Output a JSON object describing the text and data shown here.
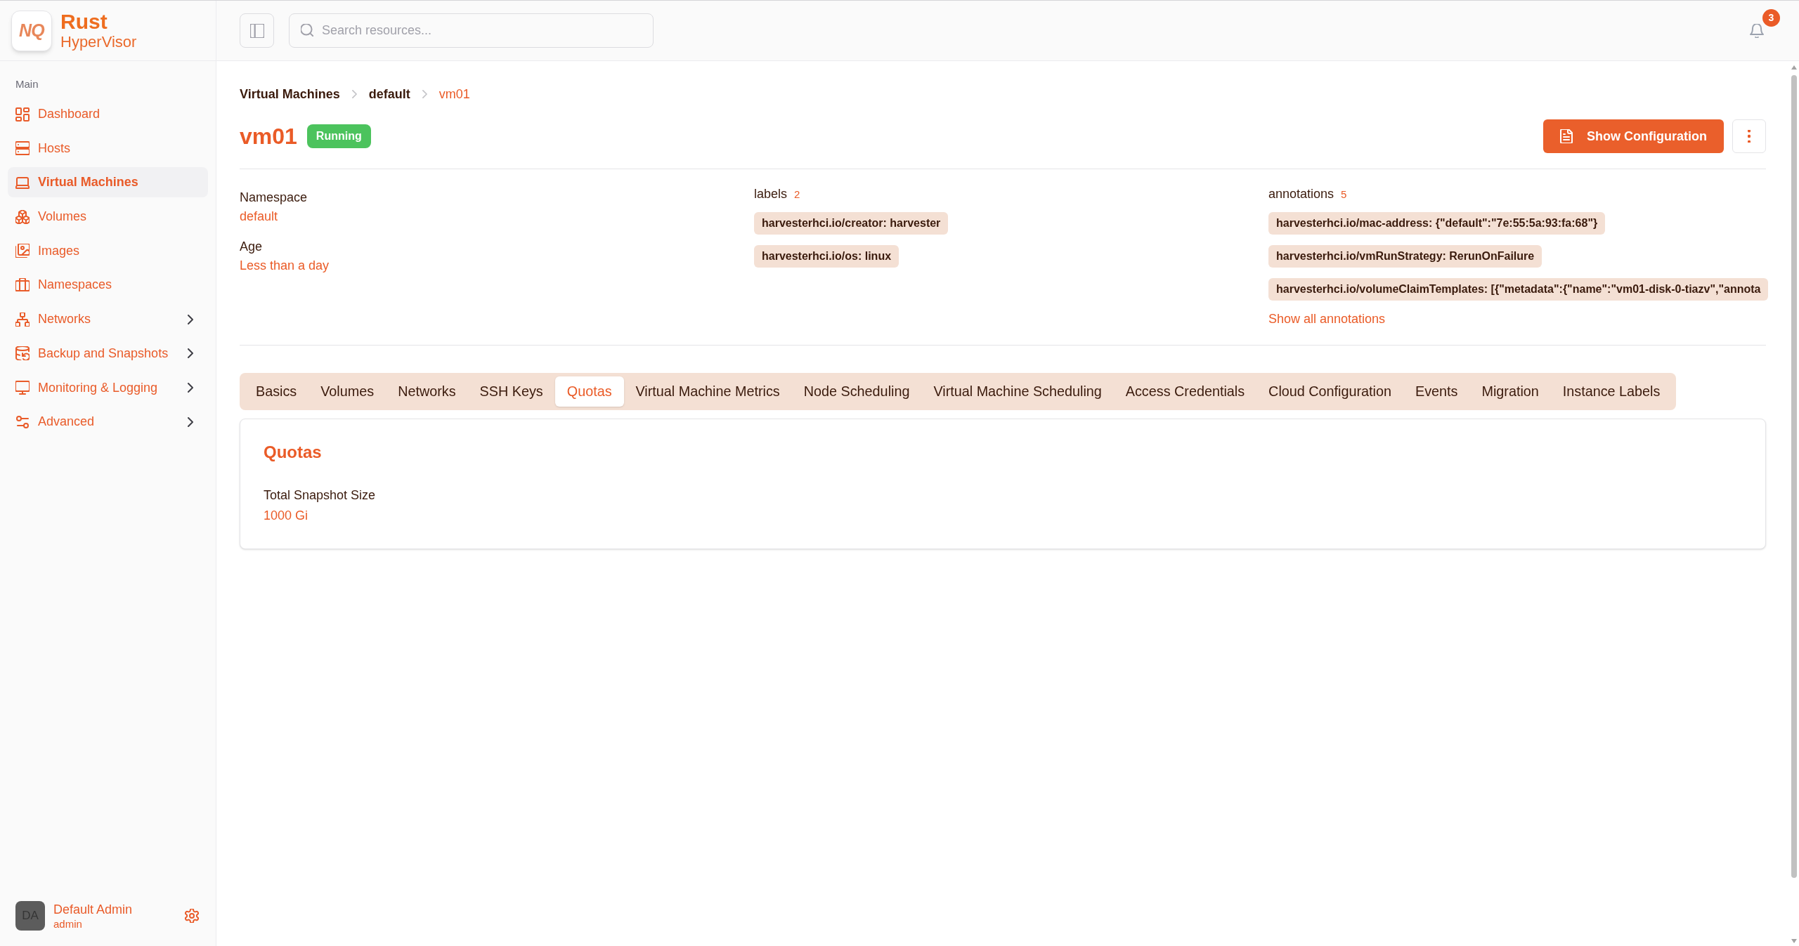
{
  "sidebar": {
    "brand": {
      "mark": "NQ",
      "name": "Rust",
      "subtitle": "HyperVisor"
    },
    "section_label": "Main",
    "items": [
      {
        "label": "Dashboard",
        "selected": false,
        "has_submenu": false
      },
      {
        "label": "Hosts",
        "selected": false,
        "has_submenu": false
      },
      {
        "label": "Virtual Machines",
        "selected": true,
        "has_submenu": false
      },
      {
        "label": "Volumes",
        "selected": false,
        "has_submenu": false
      },
      {
        "label": "Images",
        "selected": false,
        "has_submenu": false
      },
      {
        "label": "Namespaces",
        "selected": false,
        "has_submenu": false
      },
      {
        "label": "Networks",
        "selected": false,
        "has_submenu": true
      },
      {
        "label": "Backup and Snapshots",
        "selected": false,
        "has_submenu": true
      },
      {
        "label": "Monitoring & Logging",
        "selected": false,
        "has_submenu": true
      },
      {
        "label": "Advanced",
        "selected": false,
        "has_submenu": true
      }
    ],
    "user": {
      "initials": "DA",
      "name": "Default Admin",
      "role": "admin"
    }
  },
  "topbar": {
    "search": {
      "placeholder": "Search resources..."
    },
    "notifications": {
      "count": "3"
    }
  },
  "breadcrumb": [
    {
      "label": "Virtual Machines",
      "current": false
    },
    {
      "label": "default",
      "current": false
    },
    {
      "label": "vm01",
      "current": true
    }
  ],
  "header": {
    "title": "vm01",
    "status": "Running",
    "primary_action": "Show Configuration"
  },
  "details": [
    {
      "label": "Namespace",
      "value": "default"
    },
    {
      "label": "Age",
      "value": "Less than a day"
    }
  ],
  "labels": {
    "title": "labels",
    "count": "2",
    "items": [
      "harvesterhci.io/creator: harvester",
      "harvesterhci.io/os: linux"
    ]
  },
  "annotations": {
    "title": "annotations",
    "count": "5",
    "items": [
      "harvesterhci.io/mac-address: {\"default\":\"7e:55:5a:93:fa:68\"}",
      "harvesterhci.io/vmRunStrategy: RerunOnFailure",
      "harvesterhci.io/volumeClaimTemplates: [{\"metadata\":{\"name\":\"vm01-disk-0-tiazv\",\"annota"
    ],
    "link": "Show all annotations"
  },
  "tabs": [
    {
      "label": "Basics",
      "selected": false
    },
    {
      "label": "Volumes",
      "selected": false
    },
    {
      "label": "Networks",
      "selected": false
    },
    {
      "label": "SSH Keys",
      "selected": false
    },
    {
      "label": "Quotas",
      "selected": true
    },
    {
      "label": "Virtual Machine Metrics",
      "selected": false
    },
    {
      "label": "Node Scheduling",
      "selected": false
    },
    {
      "label": "Virtual Machine Scheduling",
      "selected": false
    },
    {
      "label": "Access Credentials",
      "selected": false
    },
    {
      "label": "Cloud Configuration",
      "selected": false
    },
    {
      "label": "Events",
      "selected": false
    },
    {
      "label": "Migration",
      "selected": false
    },
    {
      "label": "Instance Labels",
      "selected": false
    }
  ],
  "tab_panel": {
    "title": "Quotas",
    "fields": [
      {
        "label": "Total Snapshot Size",
        "value": "1000 Gi"
      }
    ]
  }
}
